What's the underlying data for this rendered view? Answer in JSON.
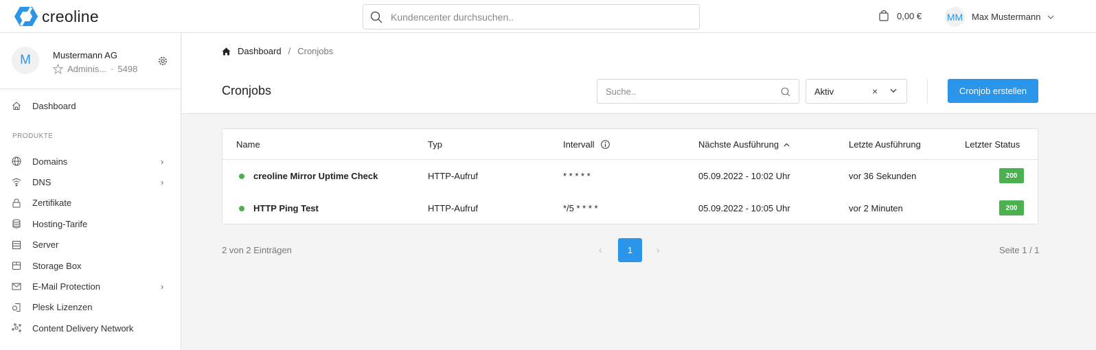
{
  "brand": {
    "name": "creoline",
    "color": "#2b95e9"
  },
  "topbar": {
    "search_placeholder": "Kundencenter durchsuchen..",
    "cart_total": "0,00 €",
    "user_initials": "MM",
    "user_name": "Max Mustermann"
  },
  "account": {
    "initial": "M",
    "name": "Mustermann AG",
    "role": "Adminis...",
    "separator": "·",
    "number": "5498"
  },
  "sidebar": {
    "dashboard": "Dashboard",
    "section": "PRODUKTE",
    "items": [
      {
        "label": "Domains",
        "icon": "globe-icon",
        "chevron": true
      },
      {
        "label": "DNS",
        "icon": "wifi-icon",
        "chevron": true
      },
      {
        "label": "Zertifikate",
        "icon": "lock-icon",
        "chevron": false
      },
      {
        "label": "Hosting-Tarife",
        "icon": "database-icon",
        "chevron": false
      },
      {
        "label": "Server",
        "icon": "server-icon",
        "chevron": false
      },
      {
        "label": "Storage Box",
        "icon": "box-icon",
        "chevron": false
      },
      {
        "label": "E-Mail Protection",
        "icon": "mail-icon",
        "chevron": true
      },
      {
        "label": "Plesk Lizenzen",
        "icon": "license-icon",
        "chevron": false
      },
      {
        "label": "Content Delivery Network",
        "icon": "network-icon",
        "chevron": false
      }
    ]
  },
  "breadcrumb": {
    "home": "Dashboard",
    "sep": "/",
    "current": "Cronjobs"
  },
  "page": {
    "title": "Cronjobs",
    "search_placeholder": "Suche..",
    "filter_value": "Aktiv",
    "filter_clear": "×",
    "create_button": "Cronjob erstellen"
  },
  "table": {
    "headers": [
      "Name",
      "Typ",
      "Intervall",
      "Nächste Ausführung",
      "Letzte Ausführung",
      "Letzter Status"
    ],
    "rows": [
      {
        "name": "creoline Mirror Uptime Check",
        "type": "HTTP-Aufruf",
        "interval": "* * * * *",
        "next": "05.09.2022 - 10:02 Uhr",
        "last": "vor 36 Sekunden",
        "status": "200"
      },
      {
        "name": "HTTP Ping Test",
        "type": "HTTP-Aufruf",
        "interval": "*/5 * * * *",
        "next": "05.09.2022 - 10:05 Uhr",
        "last": "vor 2 Minuten",
        "status": "200"
      }
    ]
  },
  "pagination": {
    "count_text": "2 von 2 Einträgen",
    "current_page": "1",
    "page_info": "Seite 1 / 1",
    "prev": "‹",
    "next": "›"
  },
  "colors": {
    "accent": "#2b95e9",
    "success": "#4caf50"
  }
}
